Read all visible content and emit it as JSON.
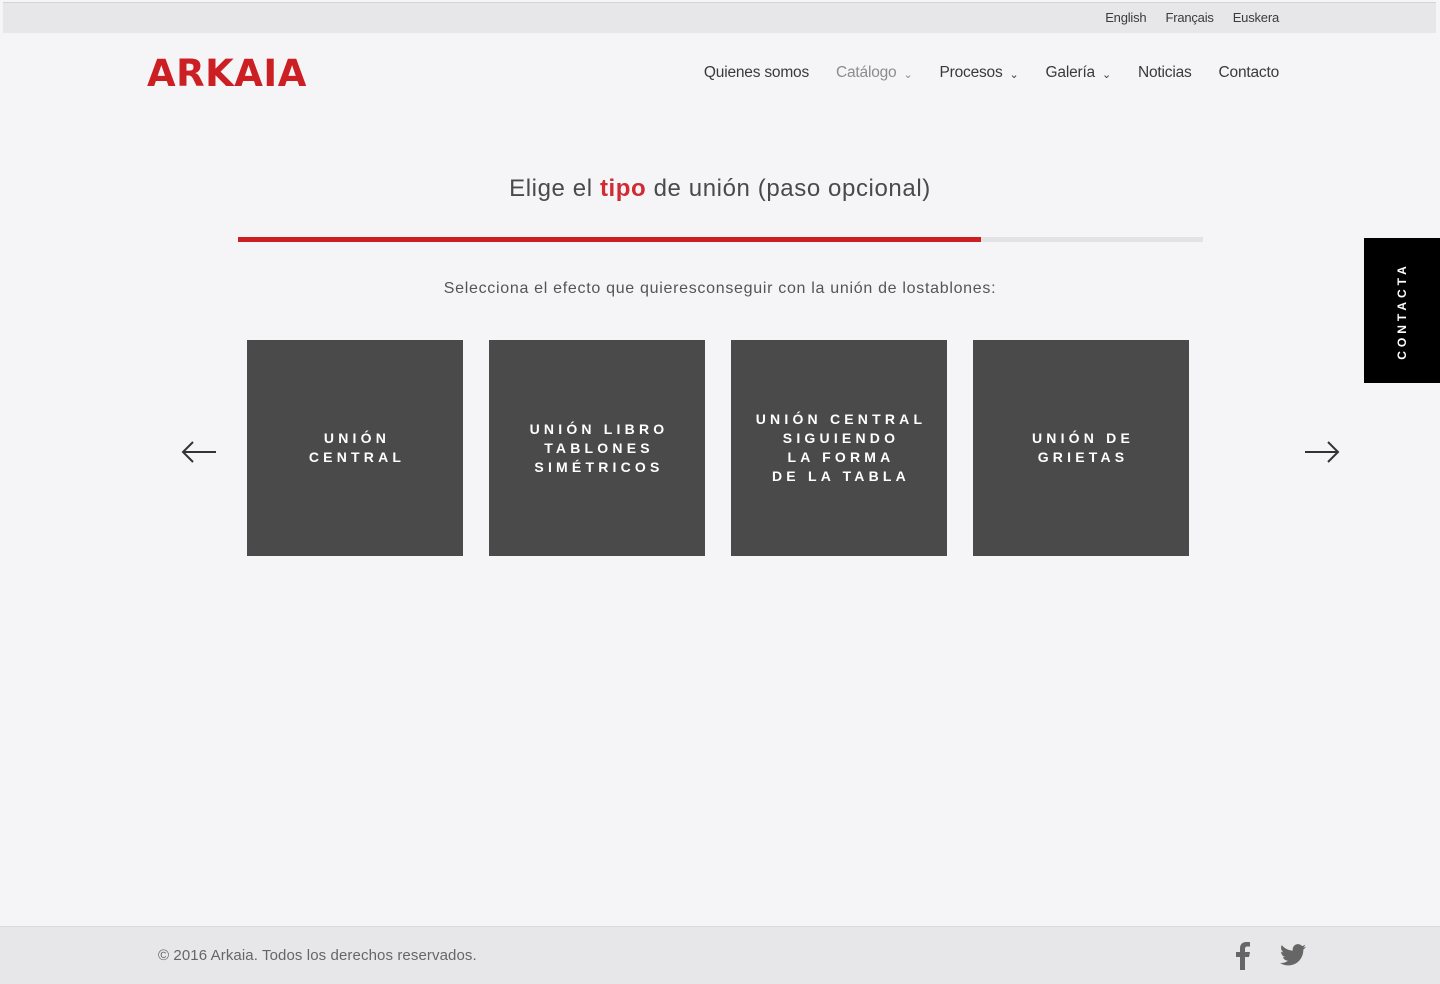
{
  "languages": [
    "English",
    "Français",
    "Euskera"
  ],
  "logo_text": "ARKAIA",
  "nav": [
    {
      "label": "Quienes somos",
      "has_dropdown": false
    },
    {
      "label": "Catálogo",
      "has_dropdown": true,
      "active": true
    },
    {
      "label": "Procesos",
      "has_dropdown": true
    },
    {
      "label": "Galería",
      "has_dropdown": true
    },
    {
      "label": "Noticias",
      "has_dropdown": false
    },
    {
      "label": "Contacto",
      "has_dropdown": false
    }
  ],
  "step": {
    "title_before": "Elige el ",
    "title_accent": "tipo",
    "title_after": " de unión (paso opcional)",
    "progress": 0.77
  },
  "subtitle": "Selecciona el efecto que quieresconseguir con la unión de lostablones:",
  "cards": [
    {
      "label": "UNIÓN\nCENTRAL"
    },
    {
      "label": "UNIÓN LIBRO\nTABLONES\nSIMÉTRICOS"
    },
    {
      "label": "UNIÓN CENTRAL\nSIGUIENDO\nLA FORMA\nDE LA TABLA"
    },
    {
      "label": "UNIÓN DE\nGRIETAS"
    }
  ],
  "icons": {
    "prev": "arrow-left-icon",
    "next": "arrow-right-icon",
    "facebook": "facebook-icon",
    "twitter": "twitter-icon"
  },
  "contact_tab": "CONTACTA",
  "footer": {
    "copyright": "© 2016 Arkaia. Todos los derechos reservados."
  },
  "colors": {
    "accent": "#cc1f24",
    "card_bg": "#4a4a4b",
    "page_bg": "#f5f5f7"
  }
}
